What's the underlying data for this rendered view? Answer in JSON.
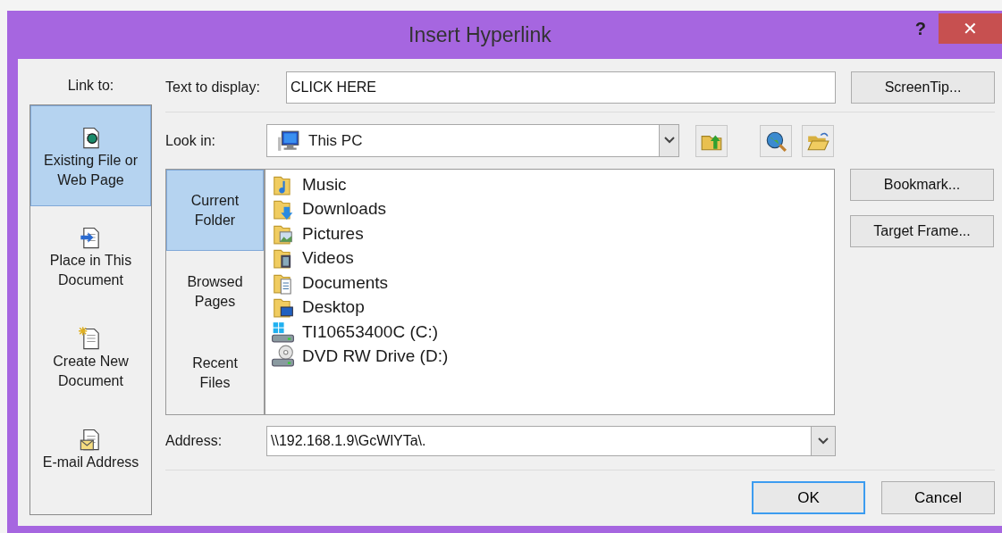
{
  "window": {
    "title": "Insert Hyperlink",
    "help": "?",
    "close": "✕"
  },
  "link_to": {
    "label": "Link to:",
    "items": [
      {
        "label": "Existing File or\nWeb Page",
        "kind": "web-file",
        "selected": true
      },
      {
        "label": "Place in This\nDocument",
        "kind": "place",
        "selected": false
      },
      {
        "label": "Create New\nDocument",
        "kind": "new",
        "selected": false
      },
      {
        "label": "E-mail Address",
        "kind": "email",
        "selected": false
      }
    ]
  },
  "text_to_display": {
    "label": "Text to display:",
    "value": "CLICK HERE"
  },
  "look_in": {
    "label": "Look in:",
    "value": "This PC"
  },
  "browse_tabs": [
    {
      "label": "Current\nFolder",
      "selected": true
    },
    {
      "label": "Browsed\nPages",
      "selected": false
    },
    {
      "label": "Recent\nFiles",
      "selected": false
    }
  ],
  "files": [
    {
      "name": "Music",
      "kind": "music"
    },
    {
      "name": "Downloads",
      "kind": "downloads"
    },
    {
      "name": "Pictures",
      "kind": "pictures"
    },
    {
      "name": "Videos",
      "kind": "videos"
    },
    {
      "name": "Documents",
      "kind": "documents"
    },
    {
      "name": "Desktop",
      "kind": "desktop"
    },
    {
      "name": "TI10653400C (C:)",
      "kind": "drive"
    },
    {
      "name": "DVD RW Drive (D:)",
      "kind": "dvd"
    }
  ],
  "address": {
    "label": "Address:",
    "value": "\\\\192.168.1.9\\GcWlYTa\\."
  },
  "side_buttons": [
    "ScreenTip...",
    "Bookmark...",
    "Target Frame..."
  ],
  "footer_buttons": [
    {
      "label": "OK",
      "focused": true
    },
    {
      "label": "Cancel",
      "focused": false
    }
  ]
}
